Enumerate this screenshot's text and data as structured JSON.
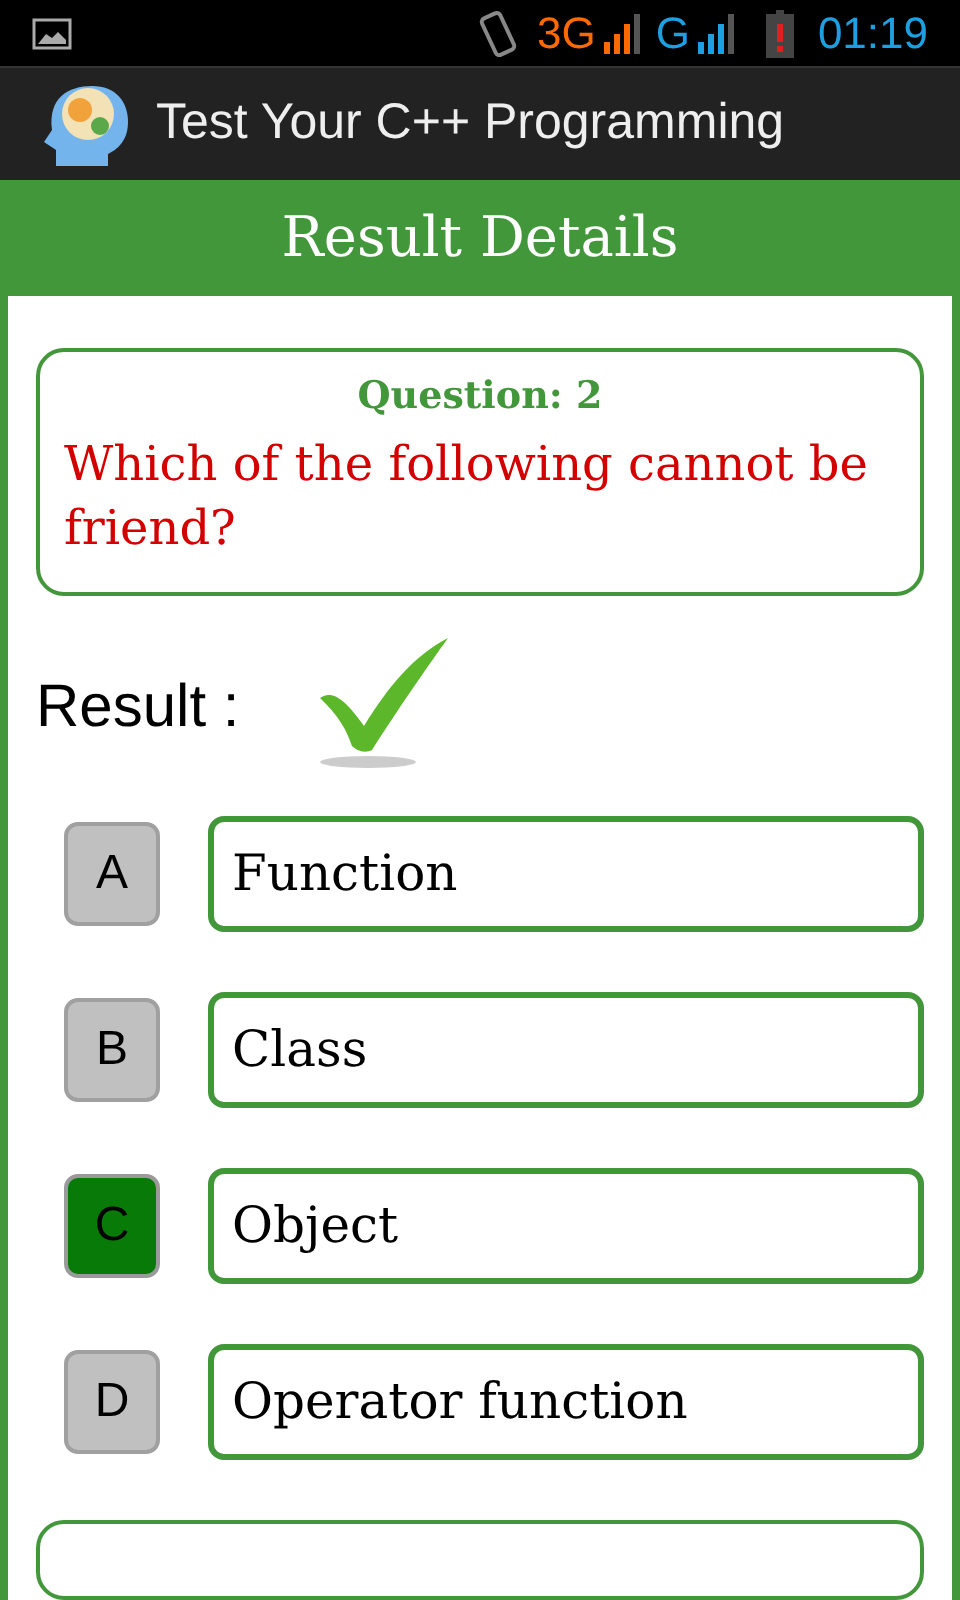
{
  "status_bar": {
    "network_1": "3G",
    "network_2": "G",
    "time": "01:19"
  },
  "app_bar": {
    "title": "Test Your C++ Programming"
  },
  "header": {
    "title": "Result Details"
  },
  "question": {
    "number_label": "Question: 2",
    "text": "Which of the following cannot be friend?"
  },
  "result": {
    "label": "Result :",
    "correct": true
  },
  "options": [
    {
      "letter": "A",
      "text": "Function",
      "selected": false
    },
    {
      "letter": "B",
      "text": "Class",
      "selected": false
    },
    {
      "letter": "C",
      "text": "Object",
      "selected": true
    },
    {
      "letter": "D",
      "text": "Operator function",
      "selected": false
    }
  ]
}
